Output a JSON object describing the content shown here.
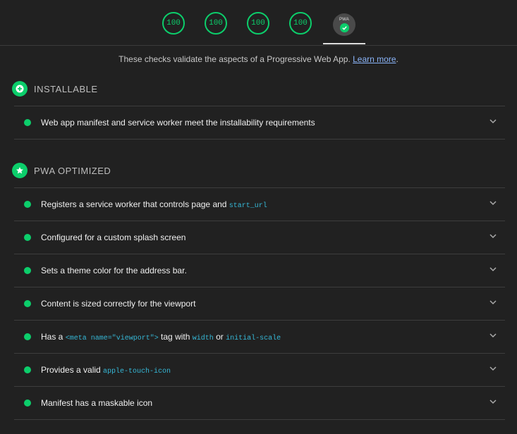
{
  "top": {
    "gauges": [
      "100",
      "100",
      "100",
      "100"
    ],
    "pwa_badge_label": "PWA"
  },
  "description": {
    "text": "These checks validate the aspects of a Progressive Web App. ",
    "link": "Learn more",
    "after": "."
  },
  "installable": {
    "title": "INSTALLABLE",
    "audits": [
      {
        "text": "Web app manifest and service worker meet the installability requirements"
      }
    ]
  },
  "pwa_optimized": {
    "title": "PWA OPTIMIZED",
    "audits": [
      {
        "t1": "Registers a service worker that controls page and ",
        "c1": "start_url"
      },
      {
        "t1": "Configured for a custom splash screen"
      },
      {
        "t1": "Sets a theme color for the address bar."
      },
      {
        "t1": "Content is sized correctly for the viewport"
      },
      {
        "t1": "Has a ",
        "c1": "<meta name=\"viewport\">",
        "t2": " tag with ",
        "c2": "width",
        "t3": " or ",
        "c3": "initial-scale"
      },
      {
        "t1": "Provides a valid ",
        "c1": "apple-touch-icon"
      },
      {
        "t1": "Manifest has a maskable icon"
      }
    ]
  },
  "colors": {
    "pass": "#0cce6b",
    "background": "#212121",
    "link": "#8ab4f8",
    "code": "#36b8d7"
  },
  "icons": {
    "installable": "plus-icon",
    "pwa_optimized": "star-icon",
    "expand": "chevron-down-icon",
    "badge": "check-icon"
  }
}
